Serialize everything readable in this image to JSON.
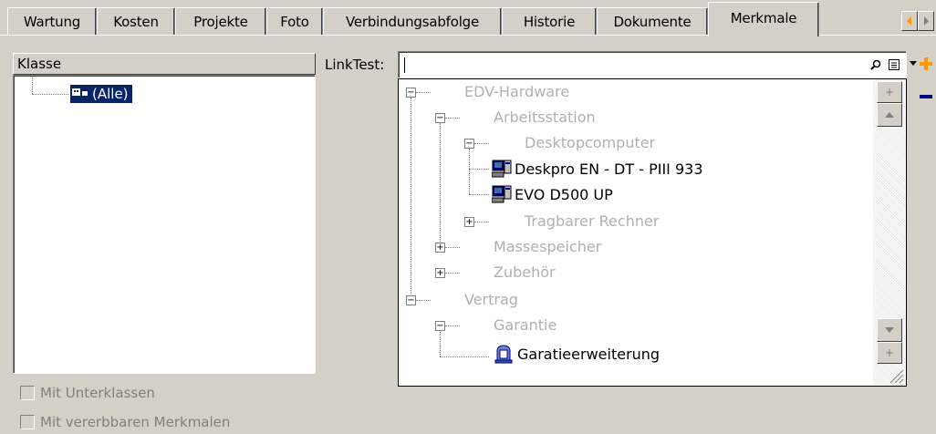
{
  "tabs": [
    {
      "label": "Wartung"
    },
    {
      "label": "Kosten"
    },
    {
      "label": "Projekte"
    },
    {
      "label": "Foto"
    },
    {
      "label": "Verbindungsabfolge"
    },
    {
      "label": "Historie"
    },
    {
      "label": "Dokumente"
    },
    {
      "label": "Merkmale",
      "active": true
    }
  ],
  "klasse": {
    "header": "Klasse",
    "node_label": "(Alle)",
    "node_icon": "class-group-icon"
  },
  "options": {
    "mit_unterklassen": "Mit Unterklassen",
    "mit_vererbbaren_merkmalen": "Mit vererbbaren Merkmalen"
  },
  "linktest": {
    "label": "LinkTest:",
    "value": ""
  },
  "tree": {
    "edv_hardware": "EDV-Hardware",
    "arbeitsstation": "Arbeitsstation",
    "desktopcomputer": "Desktopcomputer",
    "deskpro": "Deskpro EN - DT - PIII 933",
    "evo": "EVO D500 UP",
    "tragbarer_rechner": "Tragbarer Rechner",
    "massespeicher": "Massespeicher",
    "zubehoer": "Zubehör",
    "vertrag": "Vertrag",
    "garantie": "Garantie",
    "garatieerweiterung": "Garatieerweiterung"
  },
  "colors": {
    "selection": "#0a246a",
    "accent_plus": "#ff9900",
    "accent_minus": "#000080"
  }
}
